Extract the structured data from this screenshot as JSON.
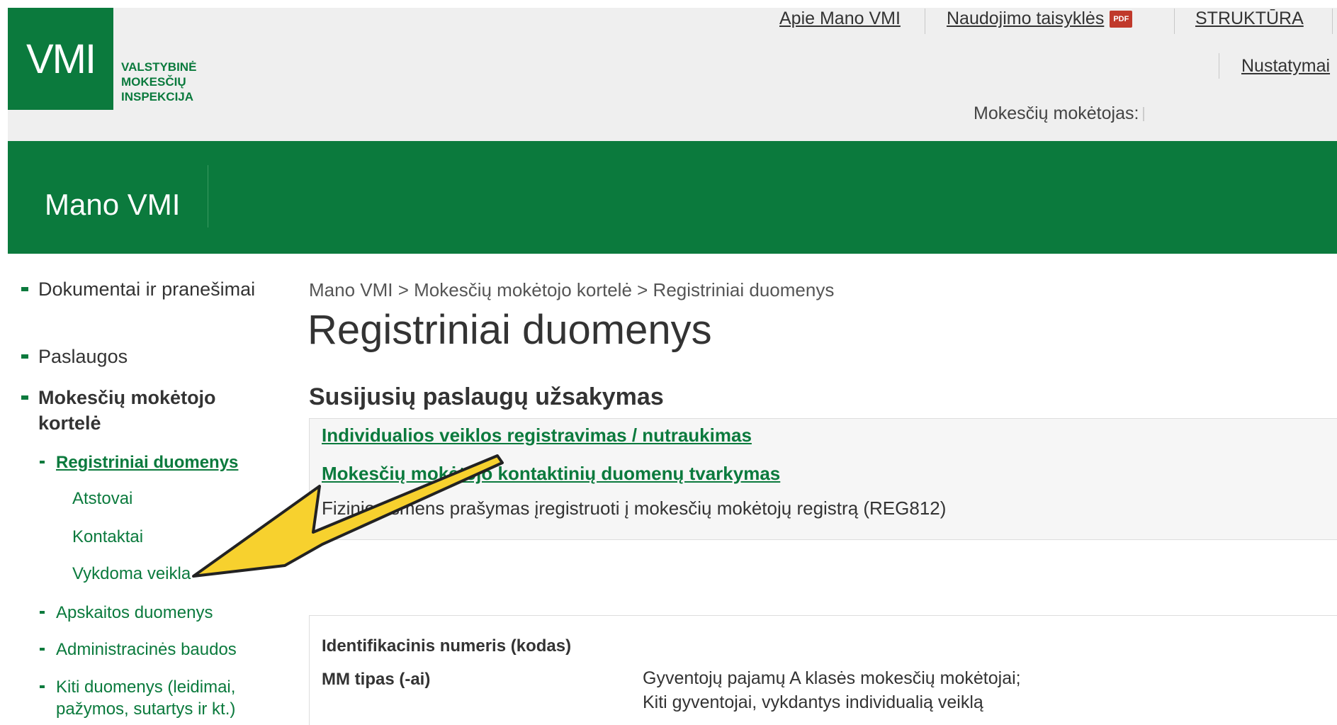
{
  "header": {
    "logo_abbr": "VMI",
    "logo_lines": [
      "VALSTYBINĖ",
      "MOKESČIŲ",
      "INSPEKCIJA"
    ],
    "links": {
      "about": "Apie Mano VMI",
      "rules": "Naudojimo taisyklės",
      "pdf_icon_label": "PDF",
      "structure": "STRUKTŪRA",
      "settings": "Nustatymai"
    },
    "taxpayer_label": "Mokesčių mokėtojas:"
  },
  "band": {
    "app_title": "Mano VMI"
  },
  "sidebar": {
    "items": [
      {
        "label": "Dokumentai ir pranešimai"
      },
      {
        "label": "Paslaugos"
      },
      {
        "label": "Mokesčių mokėtojo kortelė"
      }
    ],
    "subitems": [
      {
        "label": "Registriniai duomenys"
      },
      {
        "label": "Apskaitos duomenys"
      },
      {
        "label": "Administracinės baudos"
      },
      {
        "label": "Kiti duomenys (leidimai, pažymos, sutartys ir kt.)"
      }
    ],
    "subsubitems": [
      {
        "label": "Atstovai"
      },
      {
        "label": "Kontaktai"
      },
      {
        "label": "Vykdoma veikla"
      }
    ]
  },
  "main": {
    "breadcrumb": "Mano VMI > Mokesčių mokėtojo kortelė > Registriniai duomenys",
    "title": "Registriniai duomenys",
    "section_title": "Susijusių paslaugų užsakymas",
    "services": [
      {
        "label": "Individualios veiklos registravimas / nutraukimas"
      },
      {
        "label": "Mokesčių mokėtojo kontaktinių duomenų tvarkymas"
      }
    ],
    "service_text": "Fizinio asmens prašymas įregistruoti į mokesčių mokėtojų registrą (REG812)",
    "info": {
      "id_label": "Identifikacinis numeris (kodas)",
      "type_label": "MM tipas (-ai)",
      "type_values": [
        "Gyventojų pajamų A klasės mokesčių mokėtojai;",
        "Kiti gyventojai, vykdantys individualią veiklą"
      ]
    }
  },
  "annotation": {
    "arrow_color": "#f7d12e",
    "arrow_outline": "#222222"
  },
  "colors": {
    "brand_green": "#0b7a3d",
    "topbar_bg": "#efefef"
  }
}
